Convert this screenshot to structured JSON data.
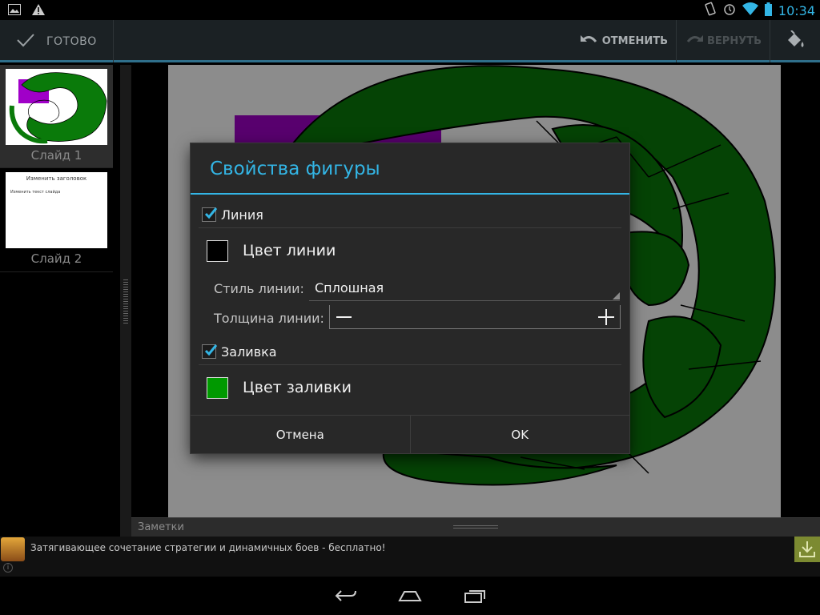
{
  "status_bar": {
    "time": "10:34"
  },
  "action_bar": {
    "done_label": "ГОТОВО",
    "undo_label": "ОТМЕНИТЬ",
    "redo_label": "ВЕРНУТЬ"
  },
  "slides": [
    {
      "caption": "Слайд 1",
      "selected": true
    },
    {
      "caption": "Слайд 2",
      "selected": false,
      "thumb_title": "Изменить заголовок",
      "thumb_text": "Изменить текст слайда"
    }
  ],
  "notes": {
    "label": "Заметки"
  },
  "ad": {
    "text": "Затягивающее сочетание стратегии и динамичных боев - бесплатно!"
  },
  "dialog": {
    "title": "Свойства фигуры",
    "line_checkbox": {
      "label": "Линия",
      "checked": true
    },
    "line_color": {
      "label": "Цвет линии",
      "color": "#000000"
    },
    "line_style": {
      "label": "Стиль линии:",
      "value": "Сплошная"
    },
    "line_width": {
      "label": "Толщина линии:"
    },
    "fill_checkbox": {
      "label": "Заливка",
      "checked": true
    },
    "fill_color": {
      "label": "Цвет заливки",
      "color": "#009900"
    },
    "cancel_label": "Отмена",
    "ok_label": "OK"
  },
  "colors": {
    "accent": "#33b5e5",
    "shape_fill": "#0a7a0a",
    "shape_rect": "#a000c8"
  }
}
